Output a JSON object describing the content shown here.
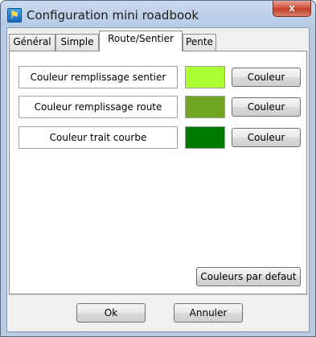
{
  "window": {
    "title": "Configuration  mini roadbook",
    "close_label": "x",
    "icon": "app-icon"
  },
  "tabs": [
    {
      "label": "Général",
      "active": false
    },
    {
      "label": "Simple",
      "active": false
    },
    {
      "label": "Route/Sentier",
      "active": true
    },
    {
      "label": "Pente",
      "active": false
    }
  ],
  "rows": [
    {
      "label": "Couleur remplissage sentier",
      "color": "#aaff33",
      "button": "Couleur"
    },
    {
      "label": "Couleur remplissage route",
      "color": "#6fa523",
      "button": "Couleur"
    },
    {
      "label": "Couleur trait courbe",
      "color": "#007b00",
      "button": "Couleur"
    }
  ],
  "defaults_button": "Couleurs par defaut",
  "footer": {
    "ok_label": "Ok",
    "cancel_label": "Annuler"
  }
}
